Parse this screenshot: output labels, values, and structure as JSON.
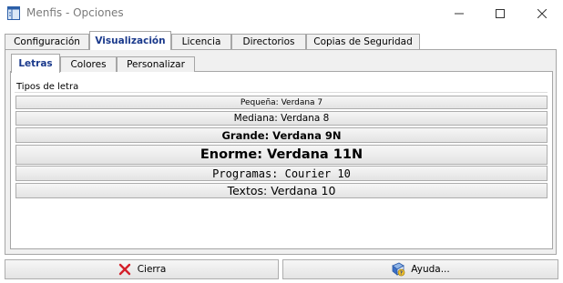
{
  "window": {
    "title": "Menfis - Opciones",
    "icon": "app-window-icon"
  },
  "outer_tabs": [
    {
      "label": "Configuración",
      "active": false
    },
    {
      "label": "Visualización",
      "active": true
    },
    {
      "label": "Licencia",
      "active": false
    },
    {
      "label": "Directorios",
      "active": false
    },
    {
      "label": "Copias de Seguridad",
      "active": false
    }
  ],
  "inner_tabs": [
    {
      "label": "Letras",
      "active": true
    },
    {
      "label": "Colores",
      "active": false
    },
    {
      "label": "Personalizar",
      "active": false
    }
  ],
  "group": {
    "label": "Tipos de letra"
  },
  "font_buttons": [
    {
      "label": "Pequeña: Verdana 7"
    },
    {
      "label": "Mediana: Verdana 8"
    },
    {
      "label": "Grande: Verdana 9N"
    },
    {
      "label": "Enorme: Verdana 11N"
    },
    {
      "label": "Programas: Courier 10"
    },
    {
      "label": "Textos: Verdana 10"
    }
  ],
  "footer": {
    "close_label": "Cierra",
    "close_icon": "red-x-icon",
    "help_label": "Ayuda...",
    "help_icon": "help-book-icon"
  },
  "colors": {
    "active_tab_text": "#1b3a8c",
    "close_icon": "#d4202a"
  }
}
